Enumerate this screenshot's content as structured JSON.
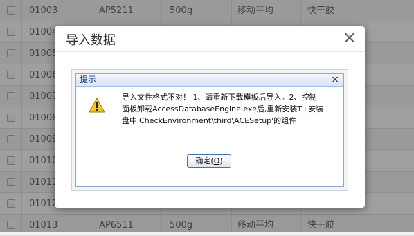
{
  "table": {
    "rows": [
      {
        "code": "01003",
        "model": "AP5211",
        "weight": "500g",
        "method": "移动平均",
        "cat": "快干胶"
      },
      {
        "code": "01004",
        "model": "",
        "weight": "",
        "method": "",
        "cat": ""
      },
      {
        "code": "01005",
        "model": "",
        "weight": "",
        "method": "",
        "cat": ""
      },
      {
        "code": "01006",
        "model": "",
        "weight": "",
        "method": "",
        "cat": ""
      },
      {
        "code": "01007",
        "model": "",
        "weight": "",
        "method": "",
        "cat": ""
      },
      {
        "code": "01008",
        "model": "",
        "weight": "",
        "method": "",
        "cat": ""
      },
      {
        "code": "01009",
        "model": "",
        "weight": "",
        "method": "",
        "cat": ""
      },
      {
        "code": "01010",
        "model": "",
        "weight": "",
        "method": "",
        "cat": ""
      },
      {
        "code": "01011",
        "model": "",
        "weight": "",
        "method": "",
        "cat": ""
      },
      {
        "code": "01012",
        "model": "",
        "weight": "",
        "method": "",
        "cat": ""
      },
      {
        "code": "01013",
        "model": "AP6511",
        "weight": "500g",
        "method": "移动平均",
        "cat": "快干胶"
      }
    ]
  },
  "dialog": {
    "title": "导入数据",
    "close_icon": "close-icon"
  },
  "message": {
    "title": "提示",
    "icon": "warning-icon",
    "text_line1": "导入文件格式不对！ 1、请重新下载模板后导入。2、控制",
    "text_line2": "面板卸载AccessDatabaseEngine.exe后,重新安装T+安装",
    "text_line3": "盘中'CheckEnvironment\\third\\ACESetup'的组件",
    "ok_label": "确定(",
    "ok_key": "O",
    "ok_close": ")"
  }
}
